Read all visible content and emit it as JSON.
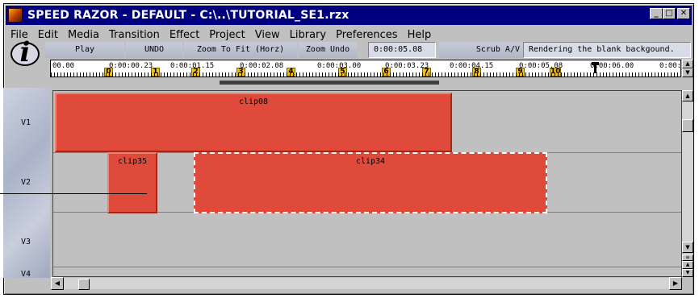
{
  "window": {
    "title": "SPEED RAZOR - DEFAULT - C:\\..\\TUTORIAL_SE1.rzx",
    "controls": {
      "minimize": "_",
      "maximize": "□",
      "close": "✕"
    }
  },
  "menu": [
    {
      "label": "File"
    },
    {
      "label": "Edit"
    },
    {
      "label": "Media"
    },
    {
      "label": "Transition"
    },
    {
      "label": "Effect"
    },
    {
      "label": "Project"
    },
    {
      "label": "View"
    },
    {
      "label": "Library"
    },
    {
      "label": "Preferences"
    },
    {
      "label": "Help"
    }
  ],
  "toolbar": {
    "play": "Play",
    "undo": "UNDO",
    "zoom_fit": "Zoom To Fit (Horz)",
    "zoom_undo": "Zoom Undo",
    "timecode": "0:00:05.08",
    "scrub": "Scrub A/V",
    "status": "Rendering the blank backgound."
  },
  "ruler": {
    "labels": [
      "00.00",
      "0:00:00.23",
      "0:00:01.15",
      "0:00:02.08",
      "0:00:03.00",
      "0:00:03.23",
      "0:00:04.15",
      "0:00:05.08",
      "0:00:06.00",
      "0:00:0"
    ],
    "markers": [
      "0",
      "1",
      "2",
      "3",
      "4",
      "5",
      "6",
      "7",
      "8",
      "9",
      "10"
    ]
  },
  "tracks": [
    {
      "label": "V1"
    },
    {
      "label": "V2"
    },
    {
      "label": "V3"
    },
    {
      "label": "V4"
    }
  ],
  "clips": [
    {
      "name": "clip08",
      "track": "V1",
      "selected": false
    },
    {
      "name": "clip35",
      "track": "V2",
      "selected": false
    },
    {
      "name": "clip34",
      "track": "V2",
      "selected": true
    }
  ],
  "colors": {
    "titlebar": "#000080",
    "clip": "#e04a3a",
    "marker": "#f0c020",
    "window": "#c0c0c0"
  }
}
